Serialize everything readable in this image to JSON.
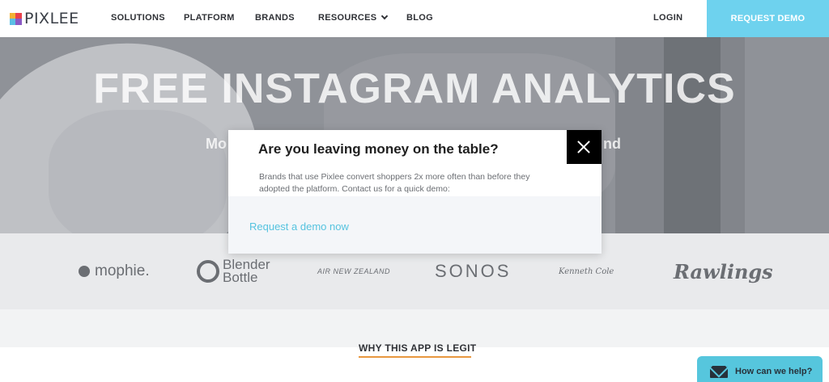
{
  "nav": {
    "logo_text": "PIXLEE",
    "items": [
      {
        "label": "SOLUTIONS"
      },
      {
        "label": "PLATFORM"
      },
      {
        "label": "BRANDS"
      },
      {
        "label": "RESOURCES"
      },
      {
        "label": "BLOG"
      }
    ],
    "login_label": "LOGIN",
    "demo_label": "REQUEST DEMO"
  },
  "hero": {
    "title": "FREE INSTAGRAM ANALYTICS",
    "sub_left": "Mo",
    "sub_right": "nd"
  },
  "brands": {
    "mophie": "mophie.",
    "blender_line1": "Blender",
    "blender_line2": "Bottle",
    "air_nz": "AIR NEW ZEALAND",
    "sonos": "SONOS",
    "kenneth_cole": "Kenneth Cole",
    "rawlings": "Rawlings"
  },
  "section": {
    "title": "WHY THIS APP IS LEGIT"
  },
  "modal": {
    "title": "Are you leaving money on the table?",
    "body": "Brands that use Pixlee convert shoppers 2x more often than before they adopted the platform. Contact us for a quick demo:",
    "link": "Request a demo now"
  },
  "chat": {
    "label": "How can we help?"
  },
  "colors": {
    "accent": "#6ed2ee",
    "link": "#55c3df",
    "underline": "#e8973f",
    "chat": "#56c6dd"
  },
  "icons": [
    "pixlee-logo-icon",
    "chevron-down-icon",
    "close-icon",
    "envelope-icon"
  ]
}
